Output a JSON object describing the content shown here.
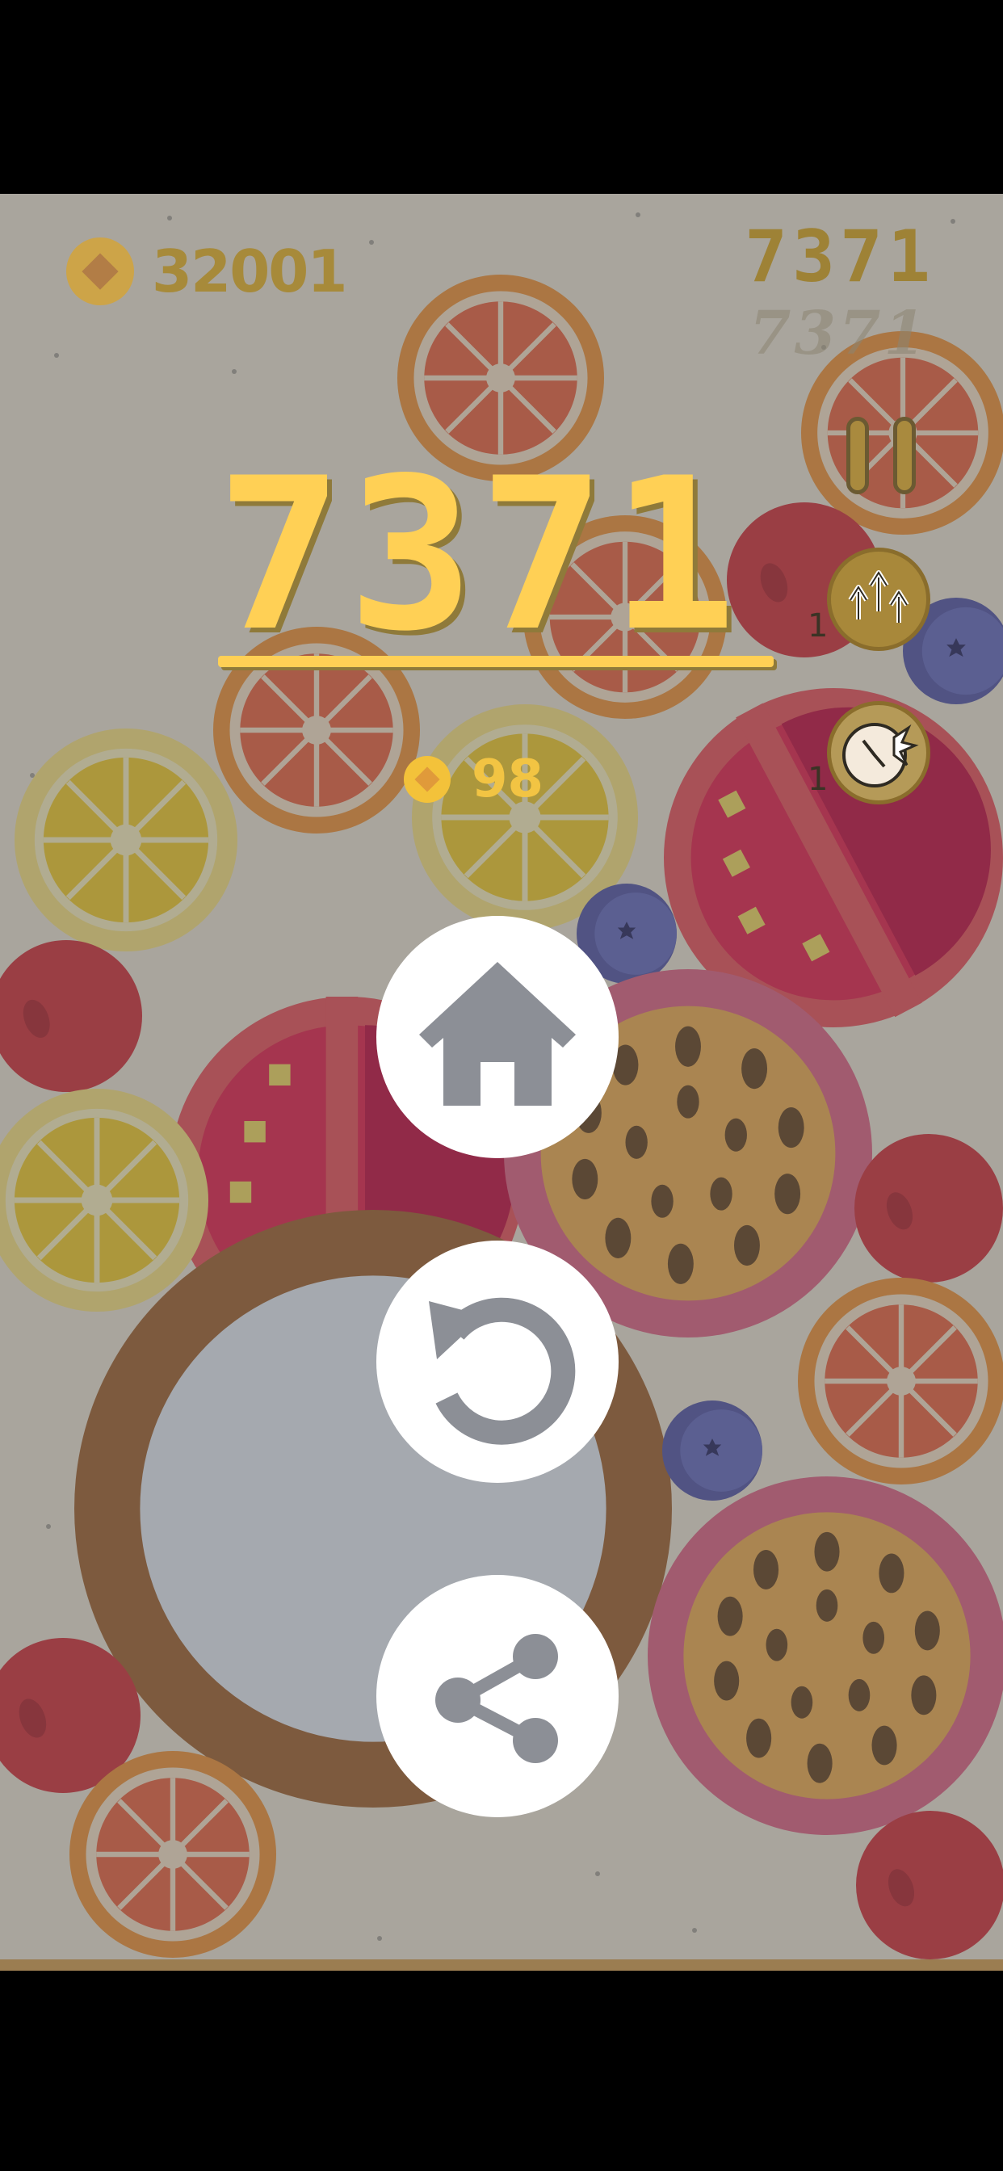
{
  "hud": {
    "coins": "32001",
    "score": "7371",
    "best": "7371"
  },
  "result": {
    "score": "7371",
    "coins_earned": "98"
  },
  "powerups": [
    {
      "icon": "arrows-up-icon",
      "count": "1"
    },
    {
      "icon": "clock-bomb-icon",
      "count": "1"
    }
  ],
  "buttons": [
    {
      "icon": "home-icon"
    },
    {
      "icon": "restart-icon"
    },
    {
      "icon": "share-icon"
    }
  ],
  "colors": {
    "score_yellow": "#ffd055",
    "coin_gold": "#f3c23a",
    "button_bg": "#ffffff",
    "icon_gray": "#8c8f96"
  }
}
